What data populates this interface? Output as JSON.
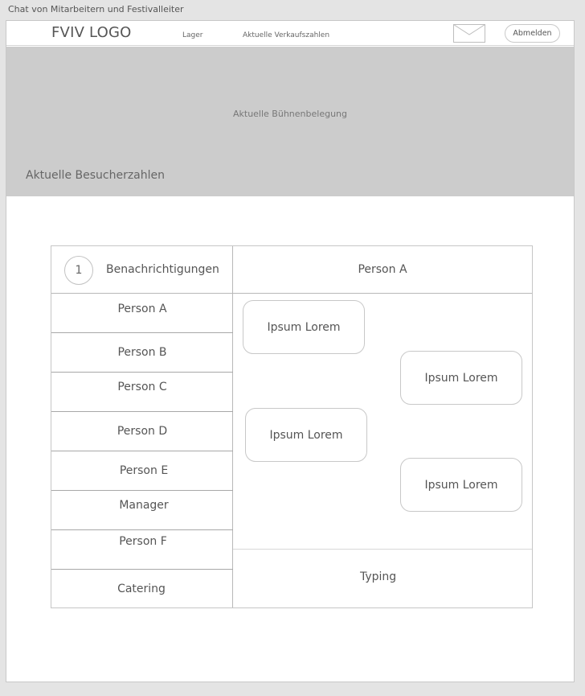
{
  "window": {
    "title": "Chat von Mitarbeitern und Festivalleiter"
  },
  "header": {
    "logo": "FVIV LOGO",
    "nav": [
      "Lager",
      "Aktuelle Verkaufszahlen"
    ],
    "mail_icon": "envelope-icon",
    "logout_label": "Abmelden"
  },
  "banner": {
    "stage_label": "Aktuelle Bühnenbelegung",
    "visitors_label": "Aktuelle Besucherzahlen"
  },
  "chat": {
    "notifications": {
      "count": "1",
      "label": "Benachrichtigungen"
    },
    "contacts": [
      "Person A",
      "Person B",
      "Person C",
      "Person D",
      "Person E",
      "Manager",
      "Person F",
      "Catering"
    ],
    "conversation": {
      "partner": "Person A",
      "messages": [
        "Ipsum Lorem",
        "Ipsum Lorem",
        "Ipsum Lorem",
        "Ipsum Lorem"
      ],
      "input_text": "Typing"
    }
  },
  "colors": {
    "banner": "#cccccc",
    "canvas": "#ffffff",
    "background": "#e4e4e4"
  }
}
